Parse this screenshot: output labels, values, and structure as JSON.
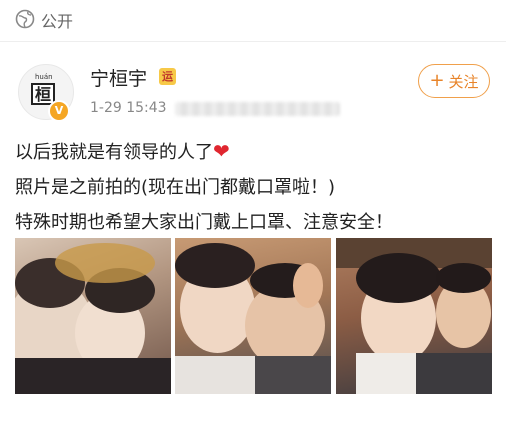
{
  "header": {
    "visibility_icon": "globe-icon",
    "visibility_label": "公开"
  },
  "post": {
    "author": {
      "avatar_pinyin": "huán",
      "avatar_char": "桓",
      "name": "宁桓宇",
      "verified_icon": "verified-v-icon",
      "badge_text": "运"
    },
    "timestamp": "1-29 15:43",
    "follow_button": {
      "icon": "plus-icon",
      "label": "关注"
    },
    "text_lines": [
      "以后我就是有领导的人了",
      "照片是之前拍的(现在出门都戴口罩啦！)",
      "特殊时期也希望大家出门戴上口罩、注意安全！"
    ],
    "emoji": "❤",
    "images": [
      "photo-1",
      "photo-2",
      "photo-3"
    ]
  },
  "colors": {
    "accent": "#e8842a",
    "heart": "#e0262f",
    "verified": "#f5a623"
  }
}
